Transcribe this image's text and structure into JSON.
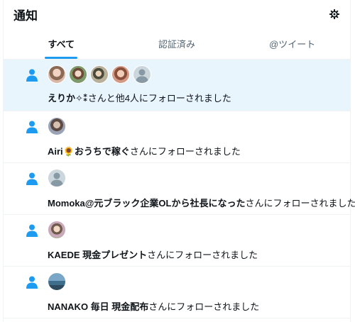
{
  "header": {
    "title": "通知",
    "settings_icon": "gear-icon"
  },
  "tabs": [
    {
      "label": "すべて",
      "active": true
    },
    {
      "label": "認証済み",
      "active": false
    },
    {
      "label": "@ツイート",
      "active": false
    }
  ],
  "notifications": [
    {
      "name": "えりか✧⁑",
      "text": "さんと他4人にフォローされました",
      "avatars": 5
    },
    {
      "name": "Airi🌻おうちで稼ぐ",
      "text": "さんにフォローされました",
      "avatars": 1
    },
    {
      "name": "Momoka@元ブラック企業OLから社長になった",
      "text": "さんにフォローされました",
      "avatars": 1
    },
    {
      "name": "KAEDE 現金プレゼント",
      "text": "さんにフォローされました",
      "avatars": 1
    },
    {
      "name": "NANAKO 毎日 現金配布",
      "text": "さんにフォローされました",
      "avatars": 1
    }
  ],
  "colors": {
    "accent": "#1d9bf0",
    "unread_bg": "#e8f5fd",
    "divider": "#eff3f4",
    "muted": "#536471"
  }
}
